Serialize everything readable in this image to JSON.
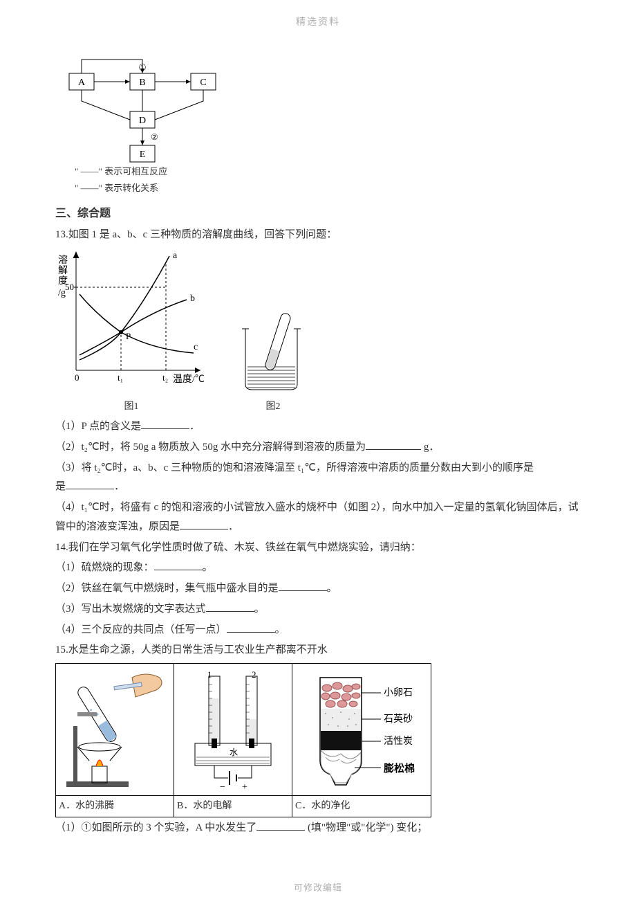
{
  "header": "精选资料",
  "footer": "可修改编辑",
  "diagram": {
    "nodes": [
      "A",
      "B",
      "C",
      "D",
      "E"
    ],
    "num1": "①",
    "num2": "②",
    "legend1": "\" ——\" 表示可相互反应",
    "legend2": "\" ——\" 表示转化关系"
  },
  "section3": "三、综合题",
  "q13": {
    "stem": "13.如图 1 是 a、b、c 三种物质的溶解度曲线，回答下列问题：",
    "axis_y": "溶解度/g",
    "axis_y_tick": "50",
    "axis_x": "温度/℃",
    "t1": "t₁",
    "t2": "t₂",
    "series_a": "a",
    "series_b": "b",
    "series_c": "c",
    "point_p": "P",
    "fig1": "图1",
    "fig2": "图2",
    "p1": "（1）P 点的含义是",
    "p1_end": "．",
    "p2a": "（2）t₂℃时，将 50g a 物质放入 50g 水中充分溶解得到溶液的质量为",
    "p2b": "g．",
    "p3a": "（3）将 t₂℃时，a、b、c 三种物质的饱和溶液降温至 t₁℃，所得溶液中溶质的质量分数由大到小的顺序是",
    "p3b": "．",
    "p4a": "（4）t₁℃时，将盛有 c 的饱和溶液的小试管放入盛水的烧杯中（如图 2），向水中加入一定量的氢氧化钠固体后，试管中的溶液变浑浊，原因是",
    "p4b": "．"
  },
  "q14": {
    "stem": "14.我们在学习氧气化学性质时做了硫、木炭、铁丝在氧气中燃烧实验，请归纳：",
    "p1": "（1）硫燃烧的现象：",
    "p2": "（2）铁丝在氧气中燃烧时，集气瓶中盛水目的是",
    "p3": "（3）写出木炭燃烧的文字表达式",
    "p4": "（4）三个反应的共同点（任写一点）",
    "end": "。"
  },
  "q15": {
    "stem": "15.水是生命之源，人类的日常生活与工农业生产都离不开水",
    "capA": "A．水的沸腾",
    "capB": "B．水的电解",
    "capC": "C．水的净化",
    "elec1": "1",
    "elec2": "2",
    "elec_water": "水",
    "plus": "+",
    "minus": "−",
    "filter1": "小卵石",
    "filter2": "石英砂",
    "filter3": "活性炭",
    "filter4": "膨松棉",
    "p1a": "（1）①如图所示的 3 个实验，A 中水发生了",
    "p1b": "(填\"物理\"或\"化学\") 变化；"
  },
  "chart_data": {
    "type": "line",
    "title": "溶解度曲线",
    "xlabel": "温度/℃",
    "ylabel": "溶解度/g",
    "x": [
      "0",
      "t₁",
      "t₂"
    ],
    "ylim": [
      0,
      80
    ],
    "series": [
      {
        "name": "a",
        "values": [
          10,
          22,
          78
        ]
      },
      {
        "name": "b",
        "values": [
          14,
          22,
          40
        ]
      },
      {
        "name": "c",
        "values": [
          40,
          22,
          15
        ]
      }
    ],
    "annotations": [
      {
        "label": "P",
        "x": "t₁",
        "y": 22,
        "note": "intersection a,b,c"
      }
    ],
    "y_ticks": [
      50
    ]
  }
}
